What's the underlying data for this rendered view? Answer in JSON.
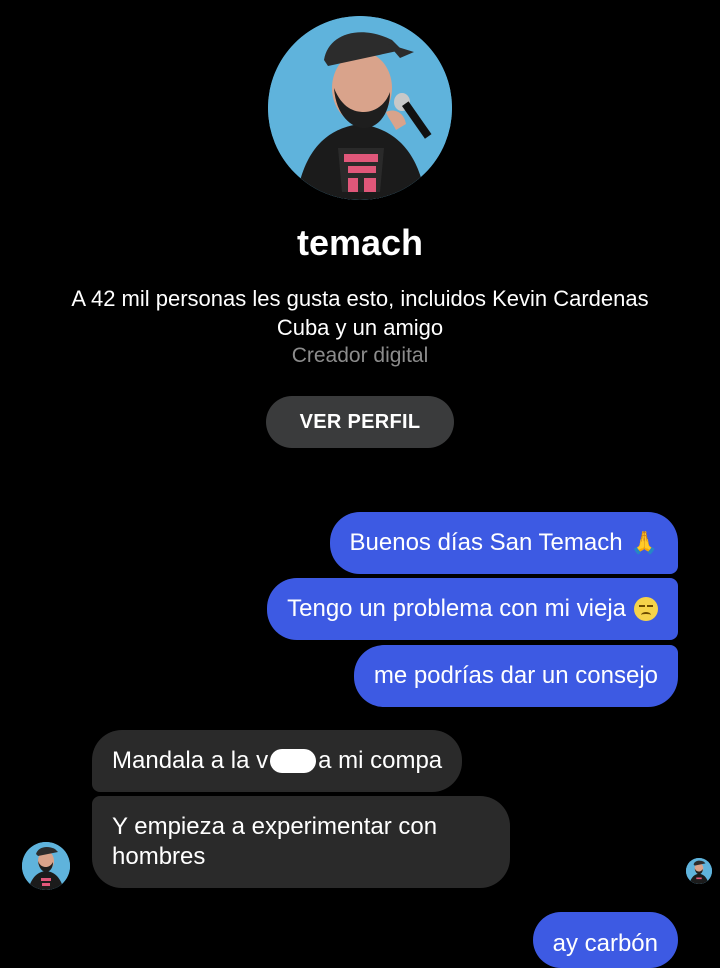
{
  "profile": {
    "name": "temach",
    "likes_text": "A 42 mil personas les gusta esto, incluidos Kevin Cardenas Cuba y un amigo",
    "category": "Creador digital",
    "view_profile_label": "VER PERFIL",
    "avatar_icon": "person-with-microphone-icon"
  },
  "messages": {
    "outgoing": [
      {
        "text": "Buenos días San Temach",
        "emoji": "folded-hands-icon",
        "emoji_glyph": "🙏"
      },
      {
        "text": "Tengo un problema con mi vieja",
        "emoji": "disappointed-face-icon"
      },
      {
        "text": "me podrías dar un consejo"
      },
      {
        "text": "ay carbón"
      }
    ],
    "incoming": [
      {
        "text_before": "Mandala a la v",
        "text_after": "a mi compa",
        "censored": true
      },
      {
        "text": "Y empieza a experimentar con hombres"
      }
    ]
  },
  "colors": {
    "background": "#000000",
    "outgoing_bubble": "#3d5ae3",
    "incoming_bubble": "#2a2a2a",
    "button": "#3a3b3c",
    "muted_text": "#8c8c8c"
  }
}
